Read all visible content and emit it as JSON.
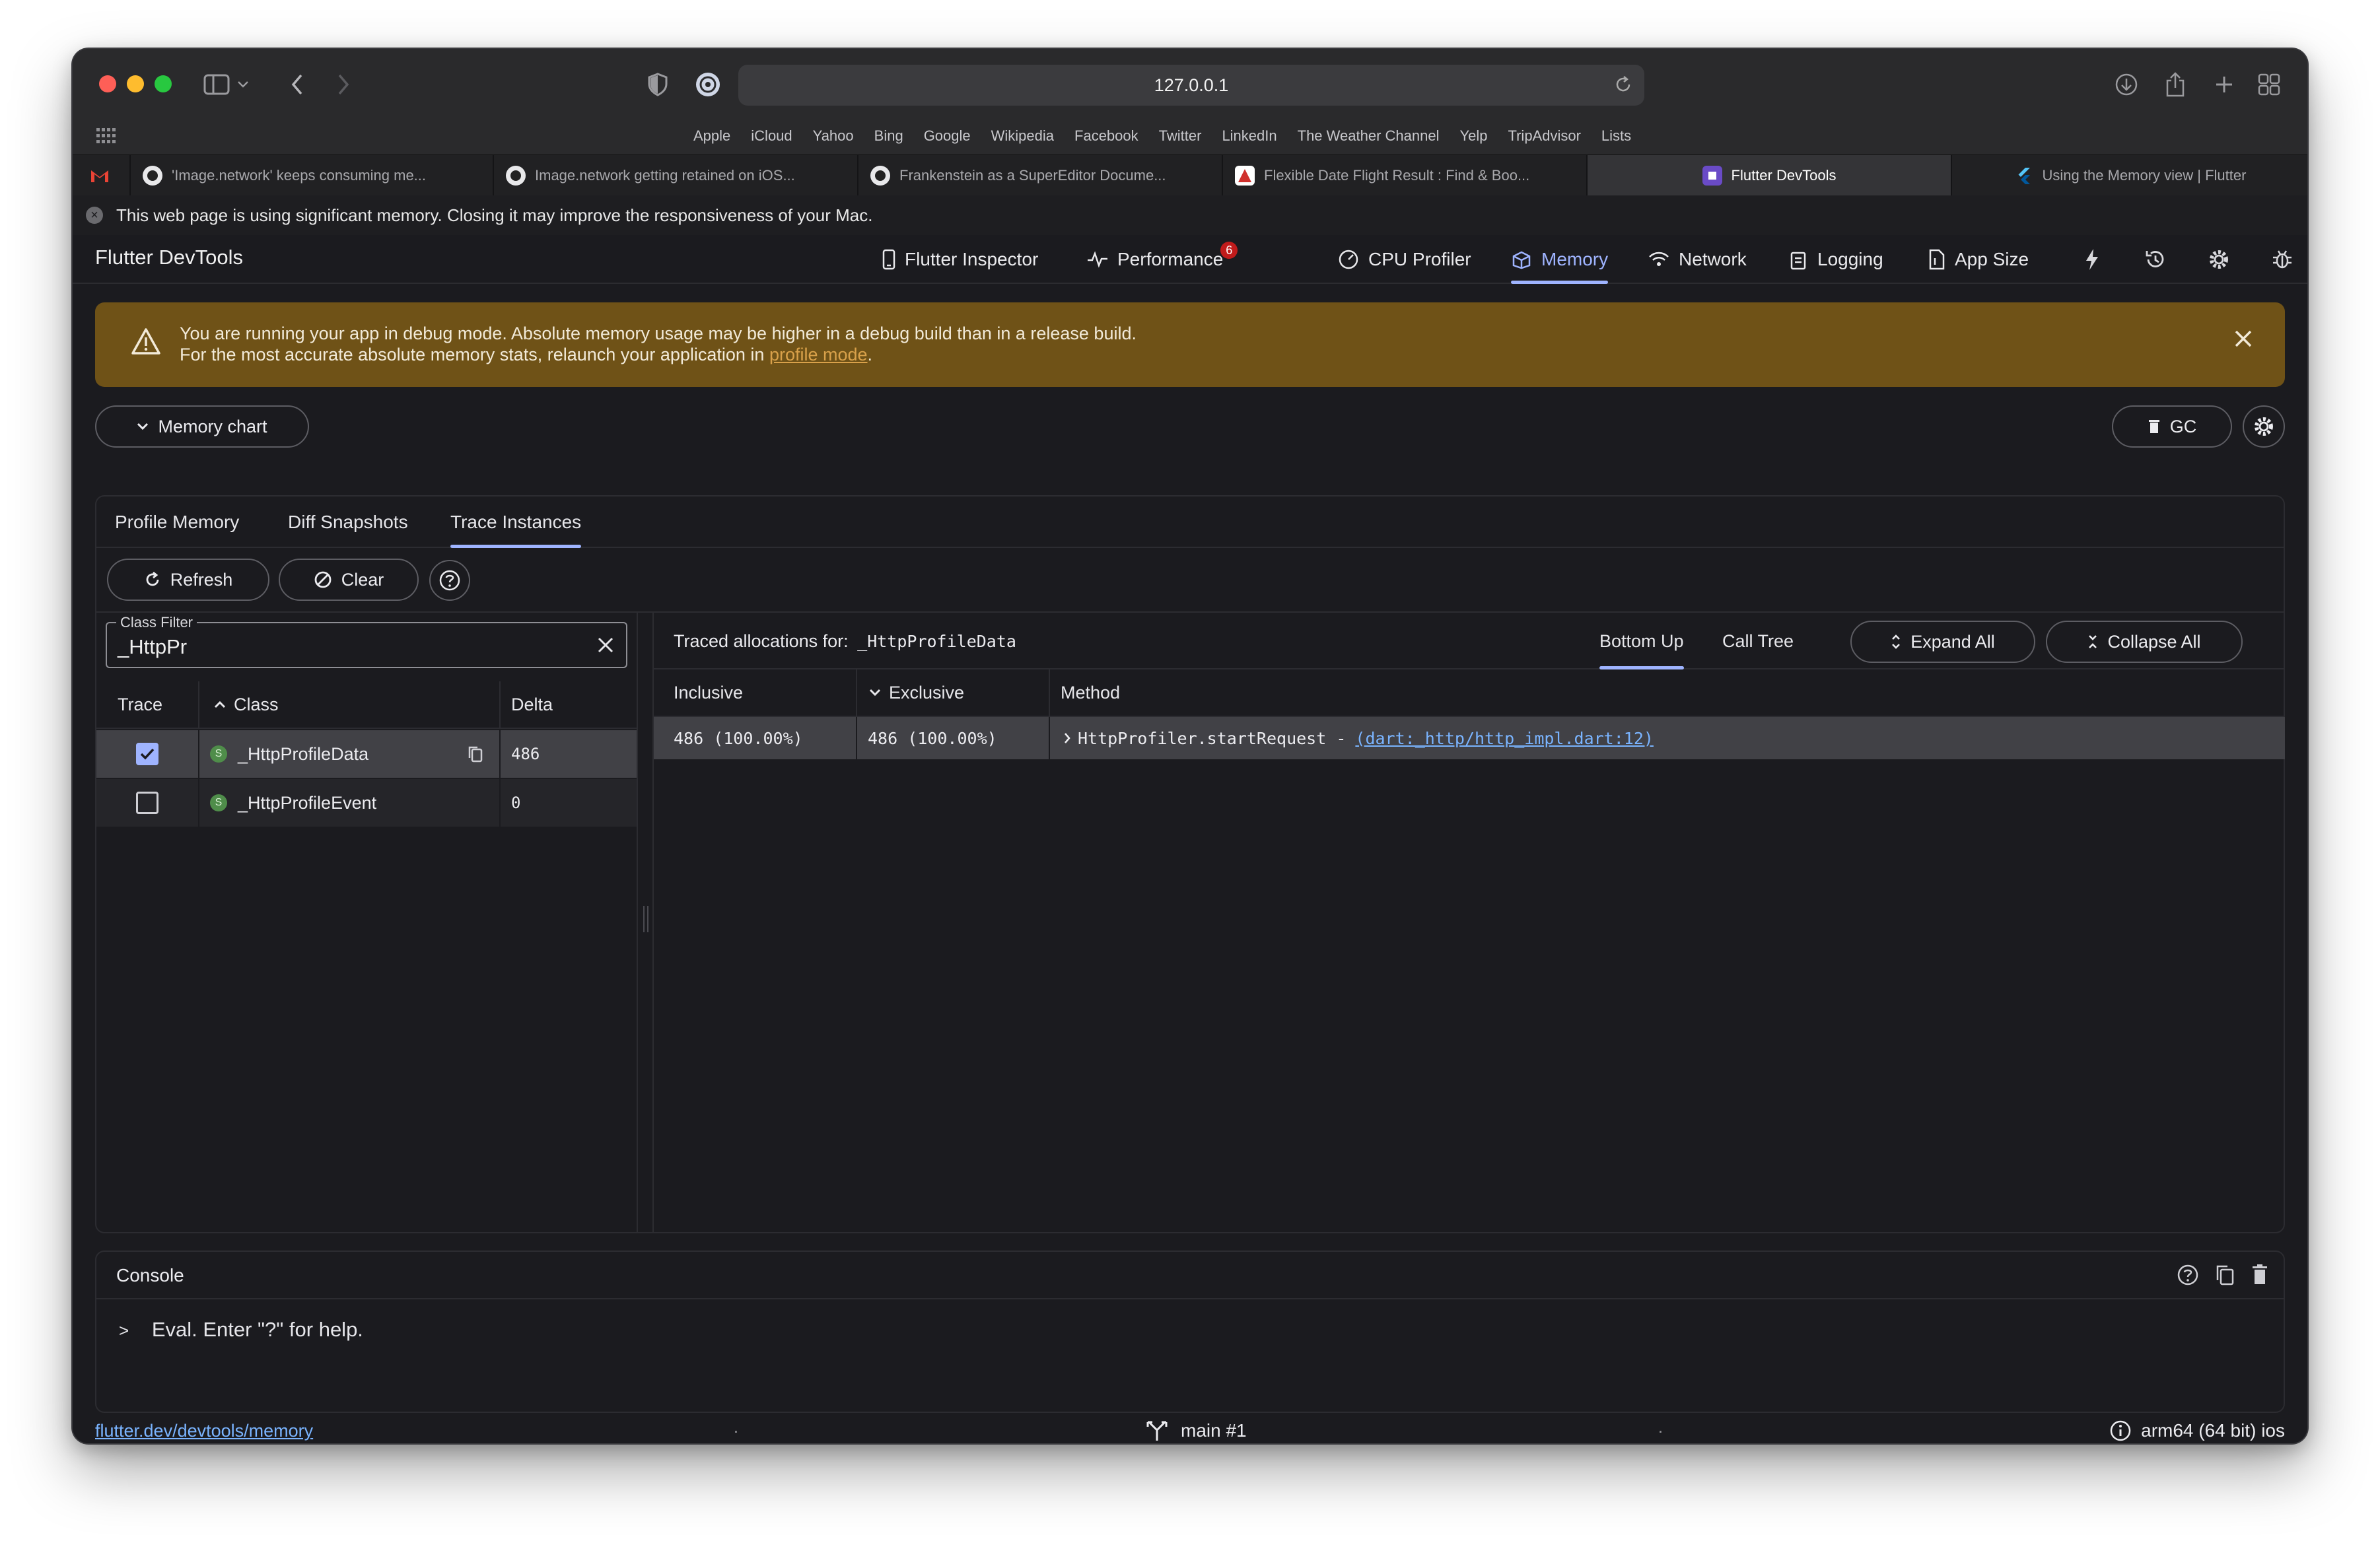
{
  "browser": {
    "url": "127.0.0.1",
    "bookmarks": [
      "Apple",
      "iCloud",
      "Yahoo",
      "Bing",
      "Google",
      "Wikipedia",
      "Facebook",
      "Twitter",
      "LinkedIn",
      "The Weather Channel",
      "Yelp",
      "TripAdvisor",
      "Lists"
    ],
    "tabs": [
      {
        "label": "'Image.network' keeps consuming me..."
      },
      {
        "label": "Image.network getting retained on iOS..."
      },
      {
        "label": "Frankenstein as a SuperEditor Docume..."
      },
      {
        "label": "Flexible Date Flight Result : Find & Boo..."
      },
      {
        "label": "Flutter DevTools"
      },
      {
        "label": "Using the Memory view | Flutter"
      }
    ],
    "memory_warning": "This web page is using significant memory. Closing it may improve the responsiveness of your Mac."
  },
  "devtools": {
    "title": "Flutter DevTools",
    "nav": [
      {
        "label": "Flutter Inspector"
      },
      {
        "label": "Performance",
        "badge": "6"
      },
      {
        "label": "CPU Profiler"
      },
      {
        "label": "Memory"
      },
      {
        "label": "Network"
      },
      {
        "label": "Logging"
      },
      {
        "label": "App Size"
      }
    ],
    "banner": {
      "line1": "You are running your app in debug mode. Absolute memory usage may be higher in a debug build than in a release build.",
      "line2_prefix": "For the most accurate absolute memory stats, relaunch your application in ",
      "line2_link": "profile mode",
      "line2_suffix": "."
    },
    "memory_chart_label": "Memory chart",
    "gc_label": "GC",
    "subtabs": [
      "Profile Memory",
      "Diff Snapshots",
      "Trace Instances"
    ],
    "actions": {
      "refresh": "Refresh",
      "clear": "Clear"
    },
    "class_filter": {
      "label": "Class Filter",
      "value": "_HttpPr"
    },
    "class_table": {
      "headers": {
        "trace": "Trace",
        "class": "Class",
        "delta": "Delta"
      },
      "rows": [
        {
          "class": "_HttpProfileData",
          "delta": "486",
          "checked": true
        },
        {
          "class": "_HttpProfileEvent",
          "delta": "0",
          "checked": false
        }
      ]
    },
    "traced": {
      "title_prefix": "Traced allocations for:",
      "class_name": "_HttpProfileData",
      "tabs": [
        "Bottom Up",
        "Call Tree"
      ],
      "expand_all": "Expand All",
      "collapse_all": "Collapse All",
      "headers": {
        "inclusive": "Inclusive",
        "exclusive": "Exclusive",
        "method": "Method"
      },
      "rows": [
        {
          "inclusive": "486 (100.00%)",
          "exclusive": "486 (100.00%)",
          "method": "HttpProfiler.startRequest - ",
          "link": "(dart:_http/http_impl.dart:12)"
        }
      ]
    },
    "console": {
      "title": "Console",
      "prompt_symbol": ">",
      "prompt": "Eval. Enter \"?\" for help."
    },
    "status": {
      "link": "flutter.dev/devtools/memory",
      "isolate": "main #1",
      "device": "arm64 (64 bit) ios"
    }
  }
}
